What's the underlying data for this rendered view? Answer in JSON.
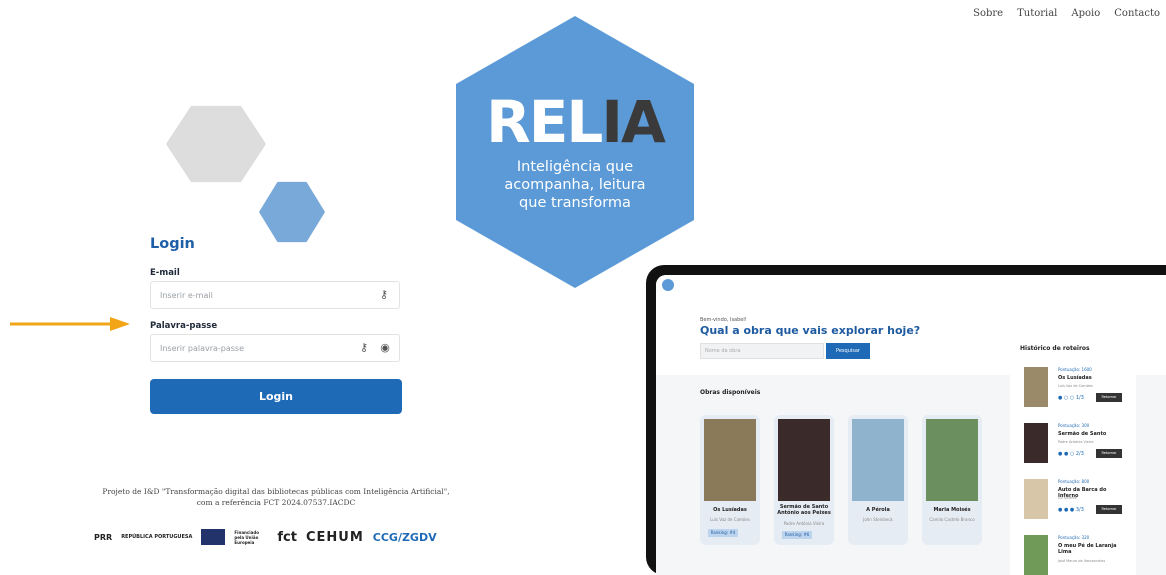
{
  "nav": {
    "links": [
      "Sobre",
      "Tutorial",
      "Apoio",
      "Contacto"
    ]
  },
  "logo": {
    "title_main": "REL",
    "title_accent": "IA",
    "tagline_lines": [
      "Inteligência que",
      "acompanha, leitura",
      "que transforma"
    ]
  },
  "login": {
    "title": "Login",
    "email_label": "E-mail",
    "email_placeholder": "Inserir e-mail",
    "email_value": "",
    "password_label": "Palavra-passe",
    "password_placeholder": "Inserir palavra-passe",
    "password_value": "",
    "submit_label": "Login"
  },
  "footer": {
    "line1": "Projeto de I&D \"Transformação digital das bibliotecas públicas com Inteligência Artificial\",",
    "line2": "com a referência FCT 2024.07537.IACDC",
    "logos": [
      "PRR",
      "REPÚBLICA PORTUGUESA",
      "Financiado pela União Europeia",
      "fct",
      "CEHUM",
      "CCG/ZGDV"
    ]
  },
  "preview": {
    "greeting": "Bem-vindo, Isabel!",
    "headline": "Qual a obra que vais explorar hoje?",
    "search_placeholder": "Nome da obra",
    "search_button": "Pesquisar",
    "section_title": "Obras disponíveis",
    "books": [
      {
        "title": "Os Lusíadas",
        "author": "Luís Vaz de Camões",
        "badge": "Ranking: #4",
        "cover": "#8a7a5a"
      },
      {
        "title": "Sermão de Santo António aos Peixes",
        "author": "Padre António Vieira",
        "badge": "Ranking: #6",
        "cover": "#3b2a2a"
      },
      {
        "title": "A Pérola",
        "author": "John Steinbeck",
        "badge": "",
        "cover": "#8fb3cc"
      },
      {
        "title": "Maria Moisés",
        "author": "Camilo Castelo Branco",
        "badge": "",
        "cover": "#6b8f5e"
      }
    ],
    "history_title": "Histórico de roteiros",
    "history": [
      {
        "score": "Pontuação: 1600",
        "title": "Os Lusíadas",
        "author": "Luís Vaz de Camões",
        "progress": "1/3",
        "action": "Retomar",
        "cover": "#9a8a6a"
      },
      {
        "score": "Pontuação: 300",
        "title": "Sermão de Santo",
        "author": "Padre António Vieira",
        "progress": "2/3",
        "action": "Retomar",
        "cover": "#3b2a2a"
      },
      {
        "score": "Pontuação: 800",
        "title": "Auto da Barca do Inferno",
        "author": "Gil Vicente",
        "progress": "3/3",
        "action": "Retomar",
        "cover": "#d8c6a8"
      },
      {
        "score": "Pontuação: 320",
        "title": "O meu Pé de Laranja Lima",
        "author": "José Mauro de Vasconcelos",
        "progress": "",
        "action": "",
        "cover": "#6f9a58"
      }
    ]
  },
  "colors": {
    "brand_blue": "#5b9ad6",
    "button_blue": "#1e6ab6",
    "arrow": "#f2a516"
  }
}
